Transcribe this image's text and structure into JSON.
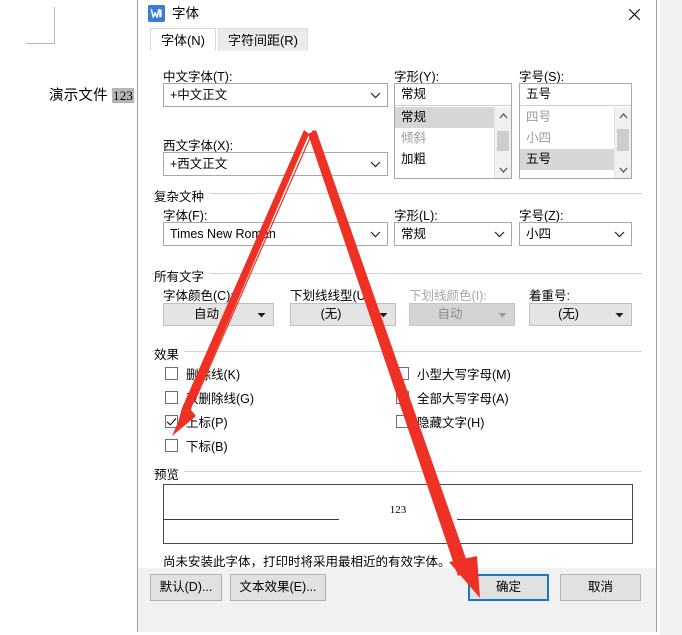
{
  "background_document": {
    "text_prefix": "演示文件 ",
    "selected_text": "123"
  },
  "dialog": {
    "title": "字体",
    "title_icon": "wps-writer-icon",
    "close_icon": "close-icon",
    "tabs": [
      {
        "label": "字体(N)",
        "active": true
      },
      {
        "label": "字符间距(R)",
        "active": false
      }
    ],
    "latin_section": {
      "chinese_font": {
        "label": "中文字体(T):",
        "value": "+中文正文"
      },
      "western_font": {
        "label": "西文字体(X):",
        "value": "+西文正文"
      },
      "font_style": {
        "label": "字形(Y):",
        "value": "常规",
        "options": [
          {
            "label": "常规",
            "selected": true,
            "dim": false
          },
          {
            "label": "倾斜",
            "selected": false,
            "dim": true
          },
          {
            "label": "加粗",
            "selected": false,
            "dim": false
          }
        ]
      },
      "font_size": {
        "label": "字号(S):",
        "value": "五号",
        "options": [
          {
            "label": "四号",
            "selected": false,
            "dim": true
          },
          {
            "label": "小四",
            "selected": false,
            "dim": true
          },
          {
            "label": "五号",
            "selected": true,
            "dim": false
          }
        ]
      }
    },
    "complex_script": {
      "group_title": "复杂文种",
      "font": {
        "label": "字体(F):",
        "value": "Times New Roman"
      },
      "style": {
        "label": "字形(L):",
        "value": "常规"
      },
      "size": {
        "label": "字号(Z):",
        "value": "小四"
      }
    },
    "all_text": {
      "group_title": "所有文字",
      "font_color": {
        "label": "字体颜色(C):",
        "value": "自动",
        "disabled": false
      },
      "underline_style": {
        "label": "下划线线型(U):",
        "value": "(无)",
        "disabled": false
      },
      "underline_color": {
        "label": "下划线颜色(I):",
        "value": "自动",
        "disabled": true
      },
      "emphasis_mark": {
        "label": "着重号:",
        "value": "(无)",
        "disabled": false
      }
    },
    "effects": {
      "group_title": "效果",
      "left_column": [
        {
          "label": "删除线(K)",
          "checked": false
        },
        {
          "label": "双删除线(G)",
          "checked": false
        },
        {
          "label": "上标(P)",
          "checked": true
        },
        {
          "label": "下标(B)",
          "checked": false
        }
      ],
      "right_column": [
        {
          "label": "小型大写字母(M)",
          "checked": false
        },
        {
          "label": "全部大写字母(A)",
          "checked": false
        },
        {
          "label": "隐藏文字(H)",
          "checked": false
        }
      ]
    },
    "preview": {
      "group_title": "预览",
      "sample_text": "123",
      "note": "尚未安装此字体，打印时将采用最相近的有效字体。"
    },
    "footer_buttons": [
      {
        "label": "默认(D)...",
        "focused": false
      },
      {
        "label": "文本效果(E)...",
        "focused": false
      },
      {
        "label": "确定",
        "focused": true
      },
      {
        "label": "取消",
        "focused": false
      }
    ]
  },
  "annotations": {
    "arrow_color": "#ee3124",
    "arrows": [
      {
        "name": "arrow-to-superscript-checkbox"
      },
      {
        "name": "arrow-to-ok-button"
      }
    ]
  }
}
